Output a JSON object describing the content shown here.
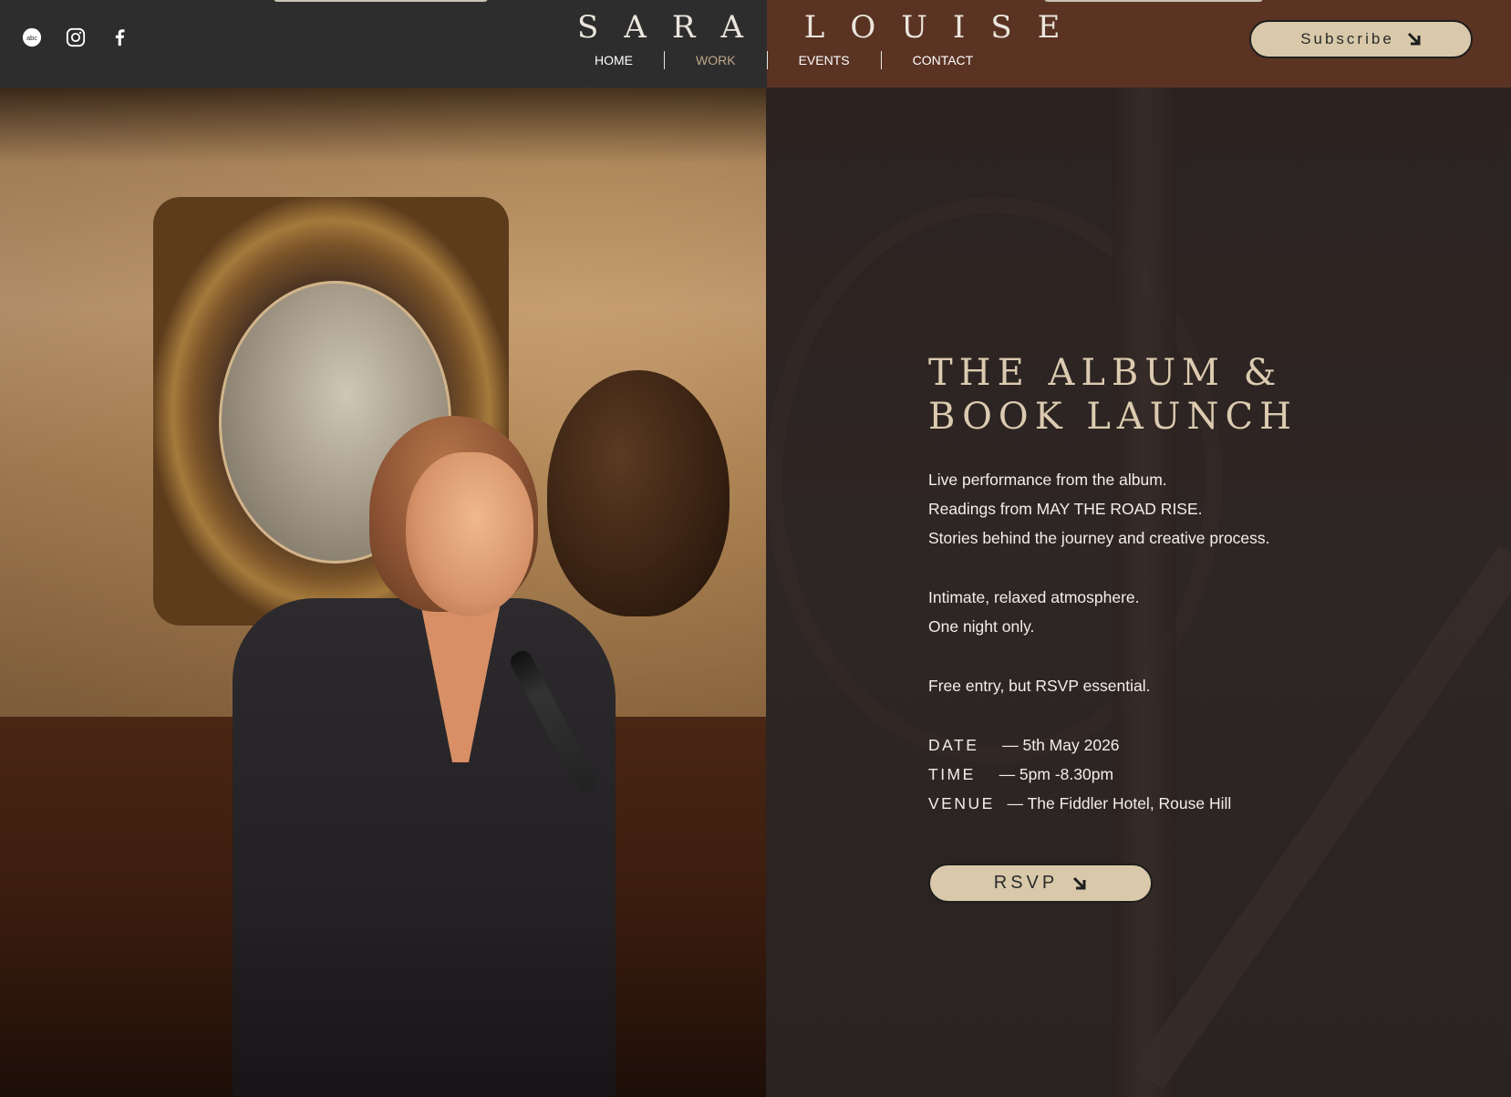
{
  "header": {
    "brand": "SARA LOUISE",
    "social_icons": [
      "abc-icon",
      "instagram-icon",
      "facebook-icon"
    ],
    "nav": [
      {
        "label": "HOME",
        "active": false
      },
      {
        "label": "WORK",
        "active": true
      },
      {
        "label": "EVENTS",
        "active": false
      },
      {
        "label": "CONTACT",
        "active": false
      }
    ],
    "subscribe_label": "Subscribe"
  },
  "event": {
    "title_line1": "THE ALBUM &",
    "title_line2": "BOOK LAUNCH",
    "lines": [
      "Live performance from the album.",
      "Readings from MAY THE ROAD RISE.",
      "Stories behind the journey and creative process."
    ],
    "lines2": [
      "Intimate, relaxed atmosphere.",
      "One night only."
    ],
    "rsvp_note": "Free entry, but RSVP essential.",
    "date_label": "DATE",
    "date_value": "— 5th May 2026",
    "time_label": "TIME",
    "time_value": "— 5pm -8.30pm",
    "venue_label": "VENUE",
    "venue_value": "— The Fiddler Hotel, Rouse Hill",
    "rsvp_button": "RSVP"
  },
  "colors": {
    "header_left": "#2d2d2d",
    "header_right": "#5a3323",
    "button_bg": "#d9c9aa",
    "title": "#dccbb0",
    "nav_active": "#bfa88a"
  }
}
